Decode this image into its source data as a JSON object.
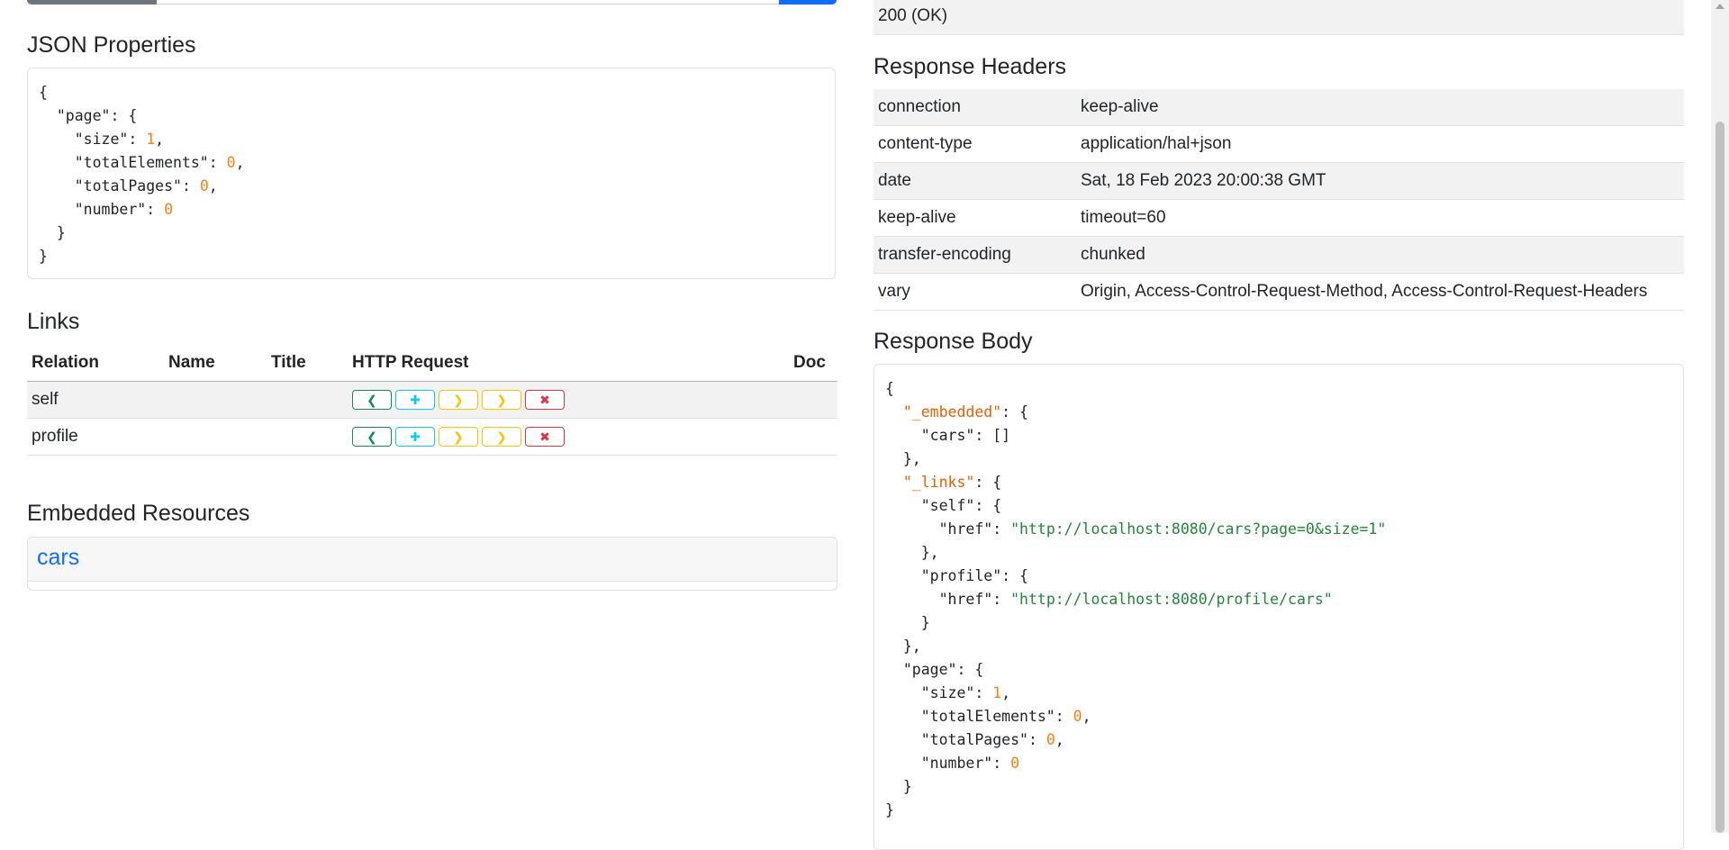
{
  "left": {
    "json_properties": {
      "heading": "JSON Properties",
      "lines": [
        [
          {
            "t": "{",
            "c": "k"
          }
        ],
        [
          {
            "t": "  \"page\": {",
            "c": "k"
          }
        ],
        [
          {
            "t": "    \"size\": ",
            "c": "k"
          },
          {
            "t": "1",
            "c": "n"
          },
          {
            "t": ",",
            "c": "k"
          }
        ],
        [
          {
            "t": "    \"totalElements\": ",
            "c": "k"
          },
          {
            "t": "0",
            "c": "n"
          },
          {
            "t": ",",
            "c": "k"
          }
        ],
        [
          {
            "t": "    \"totalPages\": ",
            "c": "k"
          },
          {
            "t": "0",
            "c": "n"
          },
          {
            "t": ",",
            "c": "k"
          }
        ],
        [
          {
            "t": "    \"number\": ",
            "c": "k"
          },
          {
            "t": "0",
            "c": "n"
          }
        ],
        [
          {
            "t": "  }",
            "c": "k"
          }
        ],
        [
          {
            "t": "}",
            "c": "k"
          }
        ]
      ]
    },
    "links": {
      "heading": "Links",
      "columns": [
        "Relation",
        "Name",
        "Title",
        "HTTP Request",
        "Doc"
      ],
      "rows": [
        {
          "relation": "self",
          "name": "",
          "title": "",
          "doc": ""
        },
        {
          "relation": "profile",
          "name": "",
          "title": "",
          "doc": ""
        }
      ],
      "buttons": [
        {
          "name": "get-button",
          "icon": "chevron-left-icon",
          "glyph": "❮",
          "color": "#198754"
        },
        {
          "name": "post-button",
          "icon": "plus-icon",
          "glyph": "✚",
          "color": "#0dcaf0"
        },
        {
          "name": "put-button",
          "icon": "chevron-right-icon",
          "glyph": "❯",
          "color": "#ffc107"
        },
        {
          "name": "patch-button",
          "icon": "chevron-right-icon",
          "glyph": "❯",
          "color": "#ffc107"
        },
        {
          "name": "delete-button",
          "icon": "close-icon",
          "glyph": "✖",
          "color": "#dc3545"
        }
      ]
    },
    "embedded": {
      "heading": "Embedded Resources",
      "items": [
        "cars"
      ]
    }
  },
  "right": {
    "status": "200 (OK)",
    "headers_heading": "Response Headers",
    "headers": [
      {
        "name": "connection",
        "value": "keep-alive"
      },
      {
        "name": "content-type",
        "value": "application/hal+json"
      },
      {
        "name": "date",
        "value": "Sat, 18 Feb 2023 20:00:38 GMT"
      },
      {
        "name": "keep-alive",
        "value": "timeout=60"
      },
      {
        "name": "transfer-encoding",
        "value": "chunked"
      },
      {
        "name": "vary",
        "value": "Origin, Access-Control-Request-Method, Access-Control-Request-Headers"
      }
    ],
    "body_heading": "Response Body",
    "body_lines": [
      [
        {
          "t": "{",
          "c": "k"
        }
      ],
      [
        {
          "t": "  ",
          "c": "k"
        },
        {
          "t": "\"_embedded\"",
          "c": "ek"
        },
        {
          "t": ": {",
          "c": "k"
        }
      ],
      [
        {
          "t": "    \"cars\": []",
          "c": "k"
        }
      ],
      [
        {
          "t": "  },",
          "c": "k"
        }
      ],
      [
        {
          "t": "  ",
          "c": "k"
        },
        {
          "t": "\"_links\"",
          "c": "ek"
        },
        {
          "t": ": {",
          "c": "k"
        }
      ],
      [
        {
          "t": "    \"self\": {",
          "c": "k"
        }
      ],
      [
        {
          "t": "      \"href\": ",
          "c": "k"
        },
        {
          "t": "\"http://localhost:8080/cars?page=0&size=1\"",
          "c": "s"
        }
      ],
      [
        {
          "t": "    },",
          "c": "k"
        }
      ],
      [
        {
          "t": "    \"profile\": {",
          "c": "k"
        }
      ],
      [
        {
          "t": "      \"href\": ",
          "c": "k"
        },
        {
          "t": "\"http://localhost:8080/profile/cars\"",
          "c": "s"
        }
      ],
      [
        {
          "t": "    }",
          "c": "k"
        }
      ],
      [
        {
          "t": "  },",
          "c": "k"
        }
      ],
      [
        {
          "t": "  \"page\": {",
          "c": "k"
        }
      ],
      [
        {
          "t": "    \"size\": ",
          "c": "k"
        },
        {
          "t": "1",
          "c": "n"
        },
        {
          "t": ",",
          "c": "k"
        }
      ],
      [
        {
          "t": "    \"totalElements\": ",
          "c": "k"
        },
        {
          "t": "0",
          "c": "n"
        },
        {
          "t": ",",
          "c": "k"
        }
      ],
      [
        {
          "t": "    \"totalPages\": ",
          "c": "k"
        },
        {
          "t": "0",
          "c": "n"
        },
        {
          "t": ",",
          "c": "k"
        }
      ],
      [
        {
          "t": "    \"number\": ",
          "c": "k"
        },
        {
          "t": "0",
          "c": "n"
        }
      ],
      [
        {
          "t": "  }",
          "c": "k"
        }
      ],
      [
        {
          "t": "}",
          "c": "k"
        }
      ]
    ]
  }
}
